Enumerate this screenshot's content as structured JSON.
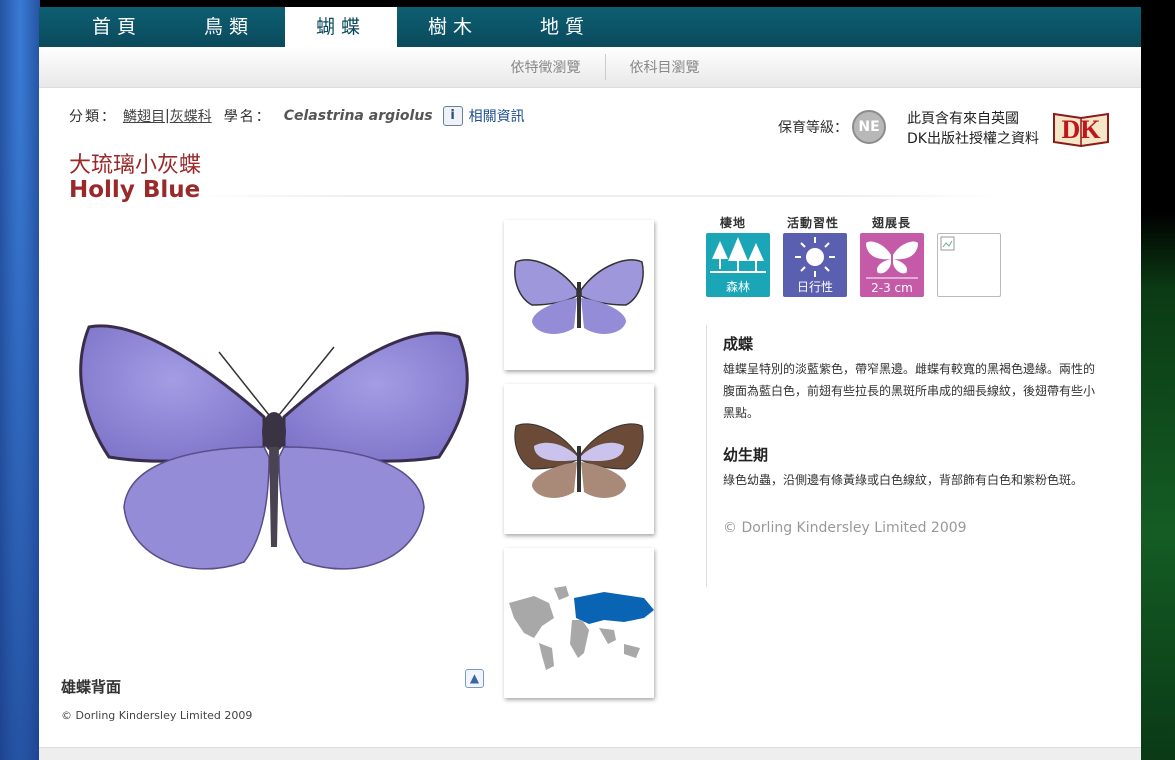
{
  "nav": {
    "items": [
      "首頁",
      "鳥類",
      "蝴蝶",
      "樹木",
      "地質"
    ],
    "active_index": 2
  },
  "subnav": {
    "by_feature": "依特徵瀏覽",
    "by_family": "依科目瀏覽"
  },
  "classification": {
    "label": "分類：",
    "order": "鱗翅目",
    "separator": "|",
    "family": "灰蝶科",
    "sci_label": "學名：",
    "sci_name": "Celastrina argiolus",
    "info_icon": "i",
    "info_link": "相關資訊"
  },
  "conservation": {
    "label": "保育等級：",
    "badge": "NE"
  },
  "dk_note": {
    "line1": "此頁含有來自英國",
    "line2": "DK出版社授權之資料",
    "logo_text": "DK"
  },
  "title": {
    "chinese": "大琉璃小灰蝶",
    "english": "Holly Blue"
  },
  "main_image": {
    "caption": "雄蝶背面",
    "copyright": "© Dorling Kindersley Limited 2009"
  },
  "icons": {
    "habitat_label": "棲地",
    "activity_label": "活動習性",
    "span_label": "翅展長",
    "habitat_value": "森林",
    "activity_value": "日行性",
    "span_value": "2-3 cm"
  },
  "description": {
    "adult_title": "成蝶",
    "adult_text": "雄蝶呈特別的淡藍紫色，帶窄黑邊。雌蝶有較寬的黑褐色邊緣。兩性的腹面為藍白色，前翅有些拉長的黑斑所串成的細長線紋，後翅帶有些小黑點。",
    "larva_title": "幼生期",
    "larva_text": "綠色幼蟲，沿側邊有條黃綠或白色線紋，背部飾有白色和紫粉色斑。",
    "copyright": "© Dorling Kindersley Limited 2009"
  },
  "colors": {
    "nav": "#0a4a5c",
    "title": "#9a2a2a",
    "wing": "#8f86d6",
    "map": "#0a64b4"
  }
}
